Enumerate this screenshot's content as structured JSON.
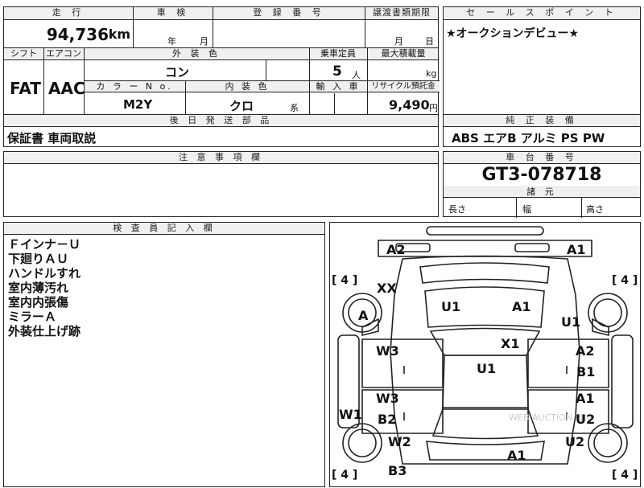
{
  "header": {
    "mileage_label": "走 行",
    "inspection_label": "車 検",
    "registration_label": "登 録 番 号",
    "transfer_label": "譲渡書類期限",
    "sales_point_label": "セ ー ル ス ポ イ ン ト"
  },
  "mileage": {
    "value": "94,736",
    "unit": "km"
  },
  "inspection": {
    "year_unit": "年",
    "month_unit": "月"
  },
  "transfer": {
    "month_unit": "月",
    "day_unit": "日"
  },
  "sales_point": {
    "text": "★オークションデビュー★"
  },
  "row2": {
    "shift_label": "シフト",
    "aircon_label": "エアコン",
    "exterior_label": "外 装 色",
    "capacity_label": "乗車定員",
    "max_load_label": "最大積載量",
    "shift_value": "FAT",
    "aircon_value": "AAC",
    "exterior_value": "コン",
    "capacity_value": "5",
    "capacity_unit": "人",
    "load_unit": "kg",
    "color_no_label": "カ ラ ー N o.",
    "interior_label": "内 装 色",
    "import_label": "輸 入 車",
    "recycle_label": "リサイクル預託金",
    "color_no_value": "M2Y",
    "interior_value": "クロ",
    "interior_suffix": "系",
    "recycle_value": "9,490",
    "recycle_unit": "円"
  },
  "parts": {
    "label": "後 日 発 送 部 品",
    "value": "保証書 車両取説"
  },
  "equipment": {
    "label": "純 正 装 備",
    "value": "ABS エアB アルミ PS PW"
  },
  "notes": {
    "label": "注 意 事 項 欄",
    "value": ""
  },
  "chassis": {
    "label": "車 台 番 号",
    "value": "GT3-078718"
  },
  "dimensions": {
    "label": "諸 元",
    "length": "長さ",
    "width": "幅",
    "height": "高さ"
  },
  "inspector": {
    "label": "検 査 員 記 入 欄",
    "lines": [
      "Ｆインナ－Ｕ",
      "下廻りＡＵ",
      "ハンドルすれ",
      "室内薄汚れ",
      "室内内張傷",
      "ミラーＡ",
      "外装仕上げ跡"
    ]
  },
  "diagram": {
    "tire_left_top": "[ 4 ]",
    "tire_right_top": "[ 4 ]",
    "tire_left_bottom": "[ 4 ]",
    "tire_right_bottom": "[ 4 ]",
    "marks": {
      "a2_top": "A2",
      "a1_top": "A1",
      "xx": "XX",
      "a_wheel": "A",
      "u1_hood_left": "U1",
      "a1_hood_right": "A1",
      "u1_right": "U1",
      "x1": "X1",
      "w3_left": "W3",
      "a2_right": "A2",
      "u1_roof": "U1",
      "b1_right": "B1",
      "w3_left2": "W3",
      "a1_right2": "A1",
      "w1_left": "W1",
      "b2_left": "B2",
      "u2_right": "U2",
      "w2_left": "W2",
      "u2_right2": "U2",
      "a1_rear": "A1",
      "b3_left": "B3"
    },
    "watermark": "WEB AUCTION PRO"
  }
}
